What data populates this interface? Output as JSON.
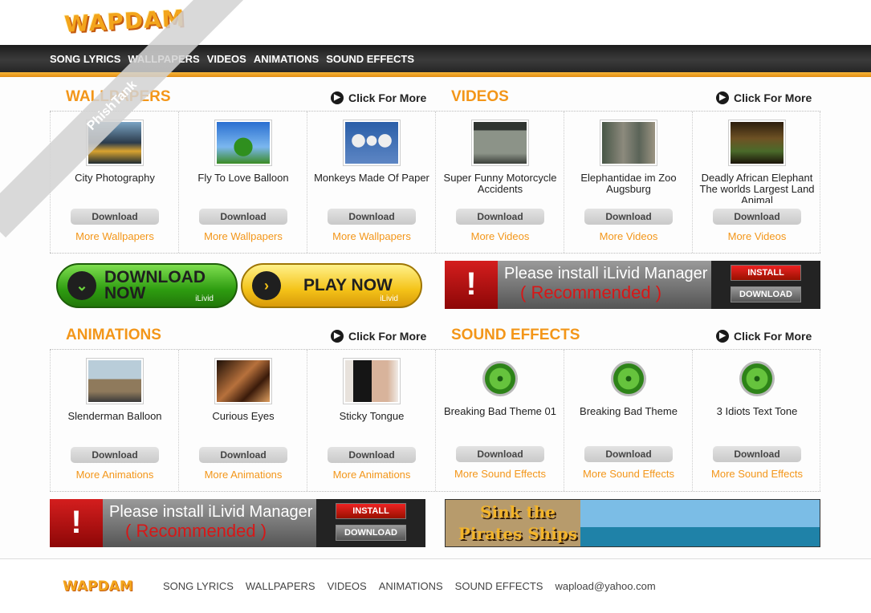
{
  "brand": {
    "logo_text": "WAPDAM",
    "watermark": "PhishTank"
  },
  "nav": [
    "SONG LYRICS",
    "WALLPAPERS",
    "VIDEOS",
    "ANIMATIONS",
    "SOUND EFFECTS"
  ],
  "more_label": "Click For More",
  "sections": {
    "wallpapers": {
      "title": "WALLPAPERS",
      "items": [
        {
          "caption": "City Photography",
          "button": "Download",
          "more": "More Wallpapers"
        },
        {
          "caption": "Fly To Love Balloon",
          "button": "Download",
          "more": "More Wallpapers"
        },
        {
          "caption": "Monkeys Made Of Paper",
          "button": "Download",
          "more": "More Wallpapers"
        }
      ]
    },
    "videos": {
      "title": "VIDEOS",
      "items": [
        {
          "caption": "Super Funny Motorcycle Accidents",
          "button": "Download",
          "more": "More Videos"
        },
        {
          "caption": "Elephantidae im Zoo Augsburg",
          "button": "Download",
          "more": "More Videos"
        },
        {
          "caption": "Deadly African Elephant The worlds Largest Land Animal",
          "button": "Download",
          "more": "More Videos"
        }
      ]
    },
    "animations": {
      "title": "ANIMATIONS",
      "items": [
        {
          "caption": "Slenderman Balloon",
          "button": "Download",
          "more": "More Animations"
        },
        {
          "caption": "Curious Eyes",
          "button": "Download",
          "more": "More Animations"
        },
        {
          "caption": "Sticky Tongue",
          "button": "Download",
          "more": "More Animations"
        }
      ]
    },
    "sounds": {
      "title": "SOUND EFFECTS",
      "items": [
        {
          "caption": "Breaking Bad Theme 01",
          "button": "Download",
          "more": "More Sound Effects"
        },
        {
          "caption": "Breaking Bad Theme",
          "button": "Download",
          "more": "More Sound Effects"
        },
        {
          "caption": "3 Idiots Text Tone",
          "button": "Download",
          "more": "More Sound Effects"
        }
      ]
    }
  },
  "ads": {
    "download_now": {
      "line1": "DOWNLOAD",
      "line2": "NOW",
      "sub": "iLivid"
    },
    "play_now": {
      "label": "PLAY NOW",
      "sub": "iLivid"
    },
    "ilivid": {
      "title": "Please install iLivid Manager",
      "recommended": "( Recommended )",
      "install": "INSTALL",
      "download": "DOWNLOAD"
    },
    "pirates": {
      "text": "Sink the Pirates Ships"
    }
  },
  "footer": {
    "logo_text": "WAPDAM",
    "links": [
      "SONG LYRICS",
      "WALLPAPERS",
      "VIDEOS",
      "ANIMATIONS",
      "SOUND EFFECTS",
      "wapload@yahoo.com"
    ]
  }
}
